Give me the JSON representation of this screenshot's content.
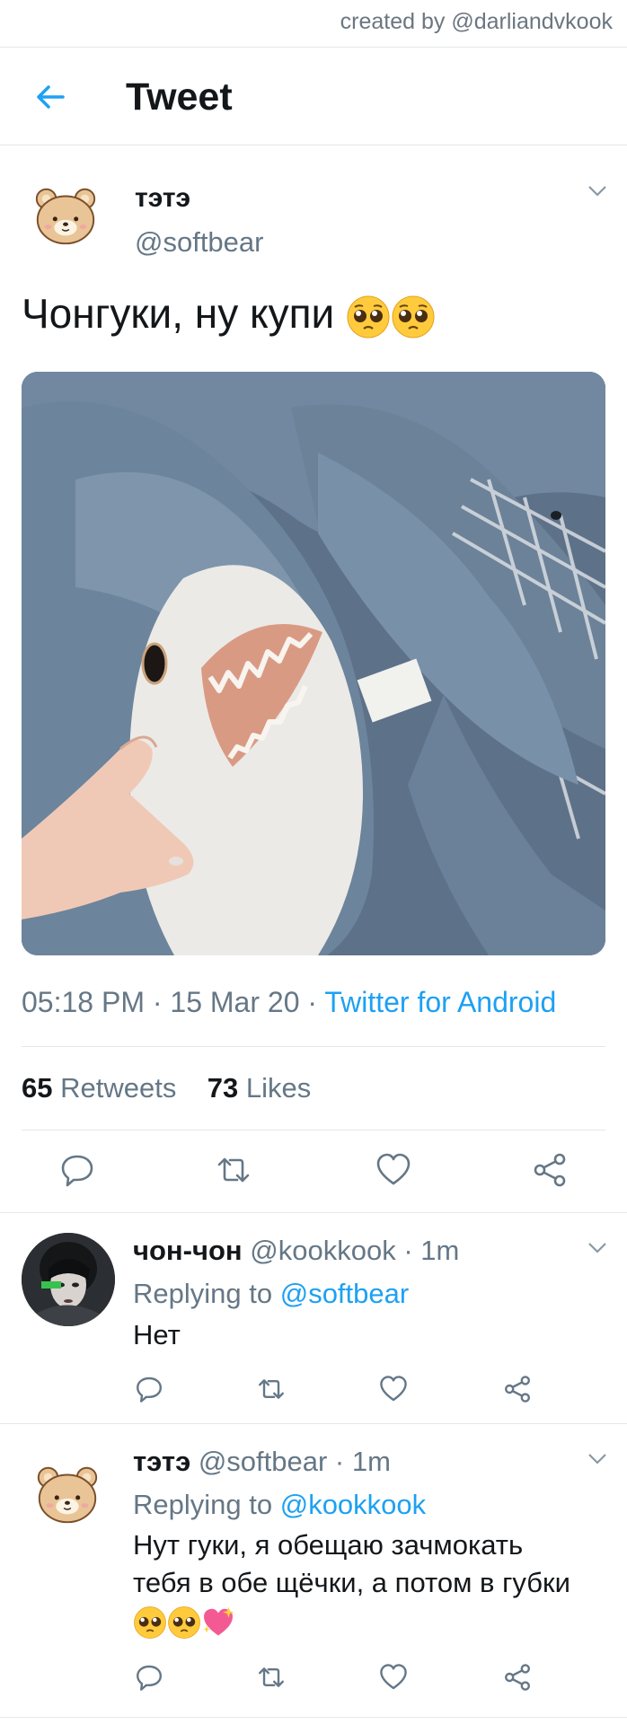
{
  "watermark": "created by @darliandvkook",
  "header": {
    "title": "Tweet"
  },
  "tweet": {
    "name": "тэтэ",
    "handle": "@softbear",
    "text": "Чонгуки, ну купи",
    "time": "05:18 PM",
    "date": "15 Mar 20",
    "source": "Twitter for Android",
    "retweets_count": "65",
    "retweets_label": "Retweets",
    "likes_count": "73",
    "likes_label": "Likes"
  },
  "replies": [
    {
      "name": "чон-чон",
      "handle": "@kookkook",
      "time": "1m",
      "replying_label": "Replying to",
      "replying_to": "@softbear",
      "text": "Нет"
    },
    {
      "name": "тэтэ",
      "handle": "@softbear",
      "time": "1m",
      "replying_label": "Replying to",
      "replying_to": "@kookkook",
      "text": "Нут гуки, я обещаю зачмокать тебя в обе щёчки, а потом в губки"
    }
  ],
  "colors": {
    "accent": "#1da1f2",
    "muted": "#657786",
    "divider": "#e1e8ed"
  },
  "icons": [
    "back-arrow-icon",
    "chevron-down-icon",
    "reply-icon",
    "retweet-icon",
    "like-icon",
    "share-icon",
    "pleading-face-emoji",
    "sparkling-heart-emoji"
  ]
}
